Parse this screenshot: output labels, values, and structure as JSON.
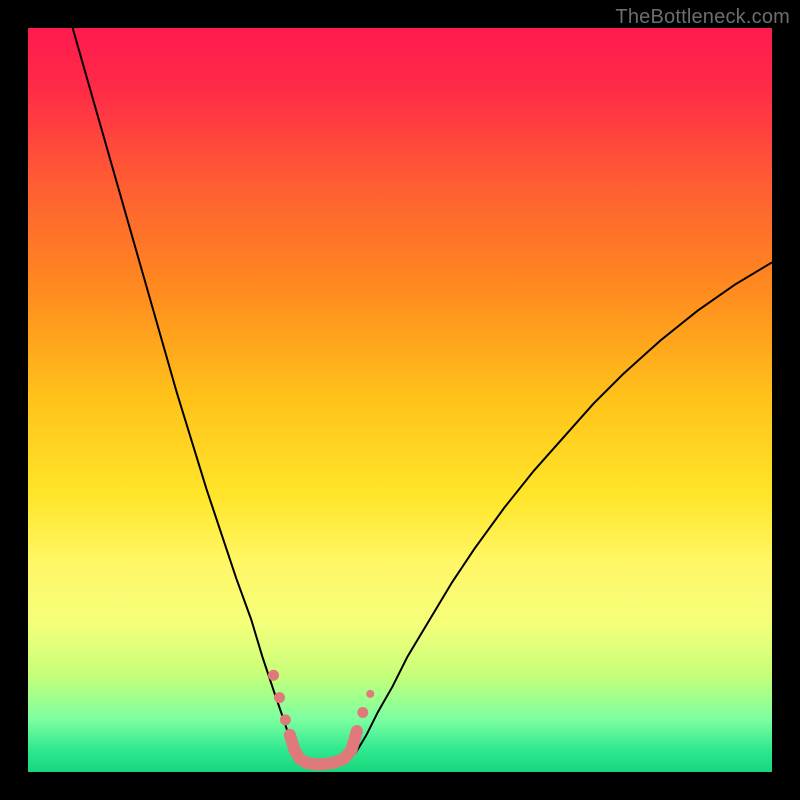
{
  "watermark": "TheBottleneck.com",
  "chart_data": {
    "type": "line",
    "title": "",
    "xlabel": "",
    "ylabel": "",
    "xlim": [
      0,
      100
    ],
    "ylim": [
      0,
      100
    ],
    "background_gradient": {
      "stops": [
        {
          "offset": 0.0,
          "color": "#ff1a4e"
        },
        {
          "offset": 0.08,
          "color": "#ff2a48"
        },
        {
          "offset": 0.2,
          "color": "#ff5a34"
        },
        {
          "offset": 0.35,
          "color": "#ff8a1f"
        },
        {
          "offset": 0.5,
          "color": "#ffc31a"
        },
        {
          "offset": 0.63,
          "color": "#ffe62a"
        },
        {
          "offset": 0.72,
          "color": "#fff766"
        },
        {
          "offset": 0.8,
          "color": "#f5ff7a"
        },
        {
          "offset": 0.87,
          "color": "#c6ff7a"
        },
        {
          "offset": 0.93,
          "color": "#7bffa0"
        },
        {
          "offset": 0.97,
          "color": "#30e88f"
        },
        {
          "offset": 1.0,
          "color": "#17d67d"
        }
      ]
    },
    "series": [
      {
        "name": "left-curve",
        "stroke": "#000000",
        "stroke_width": 2,
        "x": [
          6.0,
          8.0,
          10.0,
          12.0,
          14.0,
          16.0,
          18.0,
          20.0,
          22.0,
          24.0,
          26.0,
          28.0,
          30.0,
          31.5,
          33.0,
          34.2,
          35.2,
          36.0
        ],
        "y": [
          100.0,
          93.0,
          86.0,
          79.0,
          72.0,
          65.0,
          58.0,
          51.0,
          44.5,
          38.0,
          32.0,
          26.0,
          20.5,
          15.5,
          11.0,
          7.5,
          4.5,
          2.5
        ]
      },
      {
        "name": "right-curve",
        "stroke": "#000000",
        "stroke_width": 2,
        "x": [
          44.0,
          45.5,
          47.0,
          49.0,
          51.0,
          54.0,
          57.0,
          60.0,
          64.0,
          68.0,
          72.0,
          76.0,
          80.0,
          85.0,
          90.0,
          95.0,
          100.0
        ],
        "y": [
          2.5,
          5.0,
          8.0,
          11.5,
          15.5,
          20.5,
          25.5,
          30.0,
          35.5,
          40.5,
          45.0,
          49.5,
          53.5,
          58.0,
          62.0,
          65.5,
          68.5
        ]
      },
      {
        "name": "bottom-connector",
        "stroke": "#e07a7a",
        "stroke_width": 12,
        "linecap": "round",
        "x": [
          35.2,
          35.8,
          36.5,
          37.5,
          39.0,
          41.0,
          42.5,
          43.5,
          44.2
        ],
        "y": [
          5.0,
          3.0,
          1.8,
          1.2,
          1.0,
          1.2,
          1.8,
          3.0,
          5.5
        ]
      }
    ],
    "markers": [
      {
        "name": "left-dot-1",
        "x": 33.0,
        "y": 13.0,
        "r": 5.5,
        "fill": "#e07a7a"
      },
      {
        "name": "left-dot-2",
        "x": 33.8,
        "y": 10.0,
        "r": 5.5,
        "fill": "#e07a7a"
      },
      {
        "name": "left-dot-3",
        "x": 34.6,
        "y": 7.0,
        "r": 5.5,
        "fill": "#e07a7a"
      },
      {
        "name": "right-dot-1",
        "x": 45.0,
        "y": 8.0,
        "r": 5.5,
        "fill": "#e07a7a"
      },
      {
        "name": "right-dot-2",
        "x": 46.0,
        "y": 10.5,
        "r": 4.0,
        "fill": "#e07a7a"
      }
    ]
  }
}
